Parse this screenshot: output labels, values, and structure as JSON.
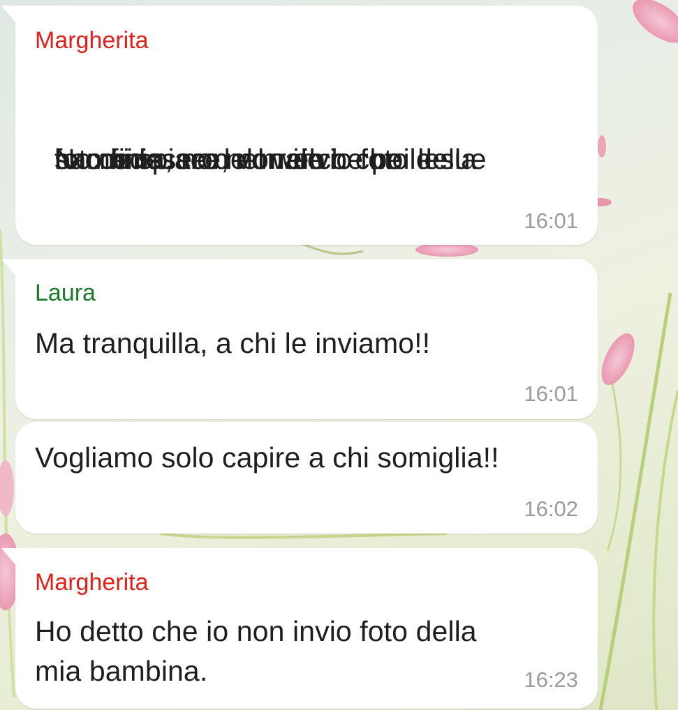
{
  "chat": {
    "messages": [
      {
        "sender": "Margherita",
        "sender_color": "#e0201b",
        "lines": [
          "No mi spiace, non invio foto della",
          "bambina, non vorrei che poi le",
          "succedesse del male o che le sue",
          "foto finissero nel web"
        ],
        "time": "16:01"
      },
      {
        "sender": "Laura",
        "sender_color": "#1b7a2a",
        "lines": [
          "Ma tranquilla, a chi le inviamo!!"
        ],
        "time": "16:01"
      },
      {
        "sender": "",
        "lines": [
          "Vogliamo solo capire a chi somiglia!!"
        ],
        "time": "16:02"
      },
      {
        "sender": "Margherita",
        "sender_color": "#e0201b",
        "lines": [
          "Ho detto che io non invio foto della",
          "mia bambina."
        ],
        "time": "16:23"
      }
    ]
  },
  "colors": {
    "bubble_bg": "#ffffff",
    "time_text": "#9a9a9a",
    "message_text": "#1e1e1e"
  }
}
